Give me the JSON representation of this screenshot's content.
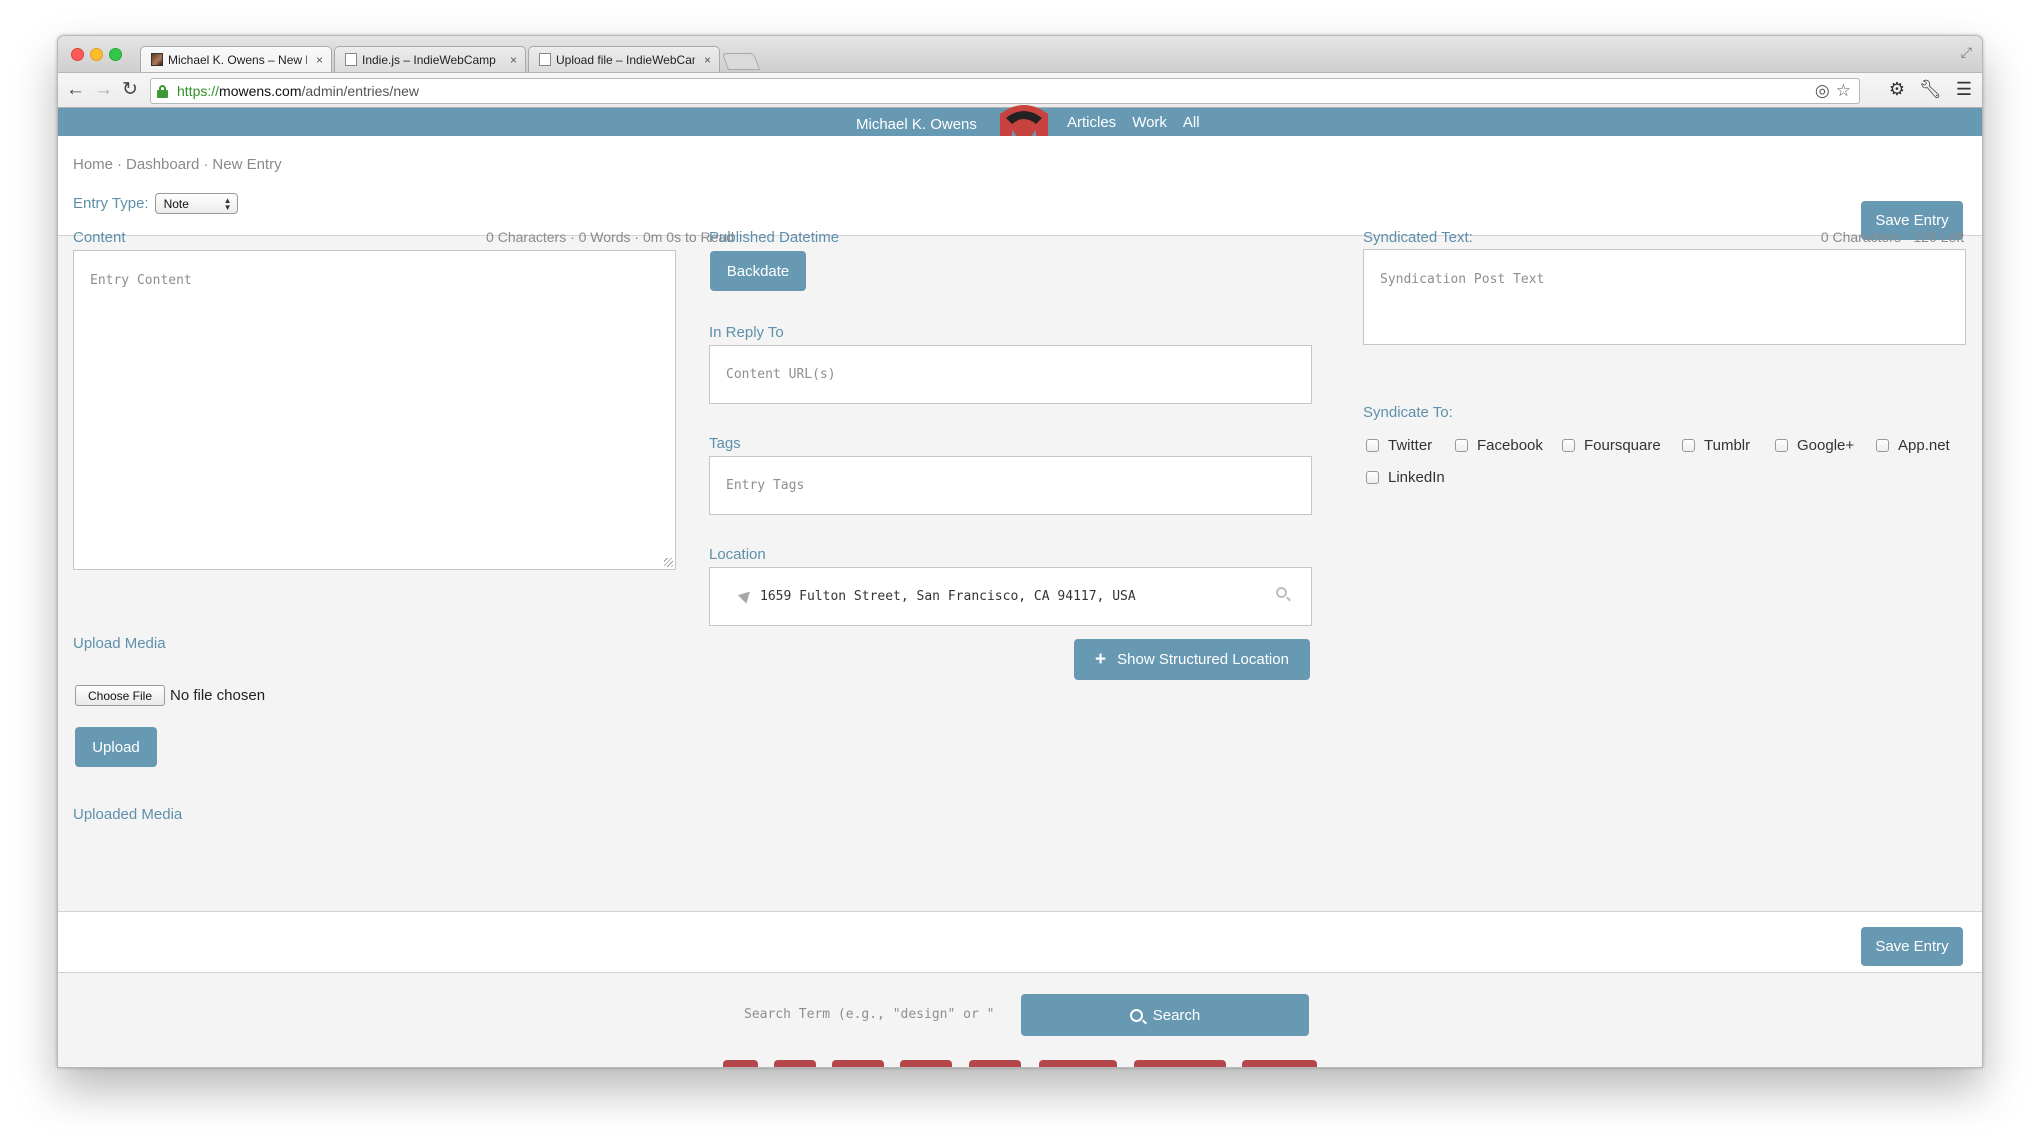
{
  "browser": {
    "tabs": [
      {
        "title": "Michael K. Owens – New E",
        "active": true,
        "favicon": "photo-favicon"
      },
      {
        "title": "Indie.js – IndieWebCamp",
        "active": false,
        "favicon": "page-favicon"
      },
      {
        "title": "Upload file – IndieWebCam",
        "active": false,
        "favicon": "page-favicon"
      }
    ],
    "url": {
      "scheme": "https://",
      "host": "mowens.com",
      "path": "/admin/entries/new"
    },
    "close_glyph": "×"
  },
  "site": {
    "name": "Michael K. Owens",
    "nav": [
      "Articles",
      "Work",
      "All"
    ],
    "brand_color": "#6899b3",
    "logo_colors": [
      "#c8433f",
      "#222222"
    ]
  },
  "breadcrumbs": [
    "Home",
    "Dashboard",
    "New Entry"
  ],
  "entry_type": {
    "label": "Entry Type:",
    "selected": "Note"
  },
  "buttons": {
    "save_entry": "Save Entry",
    "backdate": "Backdate",
    "show_location": "Show Structured Location",
    "upload": "Upload",
    "choose_file": "Choose File",
    "search": "Search"
  },
  "content": {
    "label": "Content",
    "stats": "0 Characters · 0 Words · 0m 0s to Read",
    "placeholder": "Entry Content"
  },
  "media": {
    "upload_label": "Upload Media",
    "no_file": "No file chosen",
    "uploaded_label": "Uploaded Media"
  },
  "published": {
    "label": "Published Datetime"
  },
  "reply": {
    "label": "In Reply To",
    "placeholder": "Content URL(s)"
  },
  "tags": {
    "label": "Tags",
    "placeholder": "Entry Tags"
  },
  "location": {
    "label": "Location",
    "value": "1659 Fulton Street, San Francisco, CA 94117, USA"
  },
  "syndication": {
    "text_label": "Syndicated Text:",
    "stats": "0 Characters · 120 Left",
    "placeholder": "Syndication Post Text",
    "to_label": "Syndicate To:",
    "services": [
      "Twitter",
      "Facebook",
      "Foursquare",
      "Tumblr",
      "Google+",
      "App.net",
      "LinkedIn"
    ]
  },
  "search": {
    "placeholder": "Search Term (e.g., \"design\" or \""
  },
  "accent_red": "#b5474a"
}
